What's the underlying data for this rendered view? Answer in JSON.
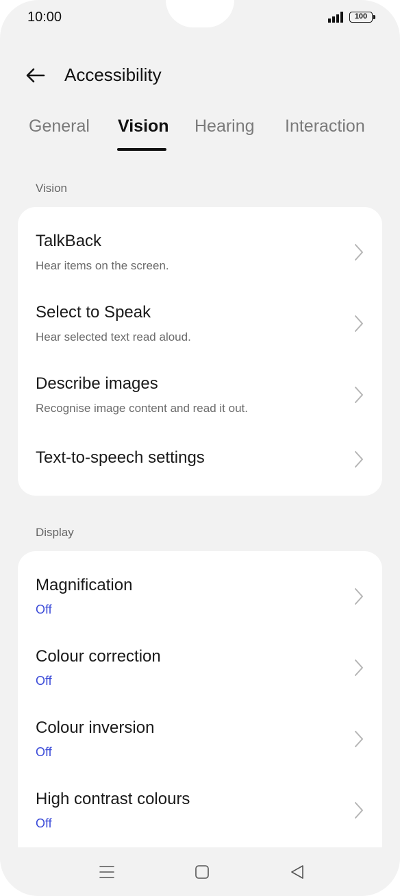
{
  "status_bar": {
    "time": "10:00",
    "battery": "100"
  },
  "header": {
    "title": "Accessibility"
  },
  "tabs": [
    {
      "label": "General",
      "active": false
    },
    {
      "label": "Vision",
      "active": true
    },
    {
      "label": "Hearing",
      "active": false
    },
    {
      "label": "Interaction",
      "active": false
    }
  ],
  "sections": [
    {
      "title": "Vision",
      "items": [
        {
          "title": "TalkBack",
          "subtitle": "Hear items on the screen."
        },
        {
          "title": "Select to Speak",
          "subtitle": "Hear selected text read aloud."
        },
        {
          "title": "Describe images",
          "subtitle": "Recognise image content and read it out."
        },
        {
          "title": "Text-to-speech settings"
        }
      ]
    },
    {
      "title": "Display",
      "items": [
        {
          "title": "Magnification",
          "status": "Off"
        },
        {
          "title": "Colour correction",
          "status": "Off"
        },
        {
          "title": "Colour inversion",
          "status": "Off"
        },
        {
          "title": "High contrast colours",
          "status": "Off"
        }
      ]
    }
  ],
  "colors": {
    "accent_status": "#3b4bd8",
    "background": "#f2f2f2",
    "card": "#ffffff"
  },
  "nav_bar": {
    "icons": [
      "menu-icon",
      "home-icon",
      "back-triangle-icon"
    ]
  }
}
